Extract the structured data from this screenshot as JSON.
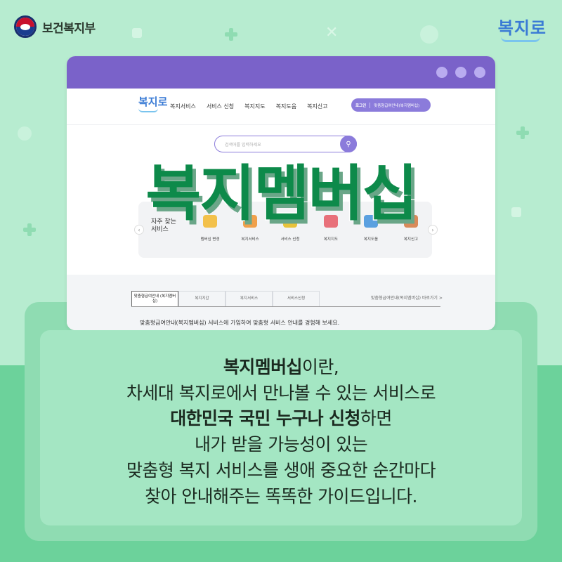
{
  "header": {
    "ministry_name": "보건복지부",
    "brand_logo": "복지로"
  },
  "browser": {
    "window_dots": 3,
    "site": {
      "logo": "복지로",
      "nav_items": [
        "복지서비스",
        "서비스 신청",
        "복지지도",
        "복지도움",
        "복지신고"
      ],
      "login_label": "로그인",
      "login_link": "맞춤형급여안내(복지멤버십)",
      "search_placeholder": "검색어를 입력하세요",
      "frequent_services_title": "자주 찾는 서비스",
      "services": [
        "멤버십 변경",
        "복지서비스",
        "서비스 신청",
        "복지지도",
        "복지도움",
        "복지신고"
      ],
      "tabs": [
        "맞춤형급여안내 (복지멤버십)",
        "복지지갑",
        "복지서비스",
        "서비스신청"
      ],
      "shortcut_link": "맞춤형급여안내(복지멤버십) 바로가기 >",
      "description": "맞춤형급여안내(복지멤버십) 서비스에 가입하여 맞춤형 서비스 안내를 경험해 보세요."
    }
  },
  "headline": "복지멤버십",
  "body_text": {
    "line1_bold": "복지멤버십",
    "line1_rest": "이란,",
    "line2": "차세대 복지로에서 만나볼 수 있는 서비스로",
    "line3_bold": "대한민국 국민 누구나 신청",
    "line3_rest": "하면",
    "line4": "내가 받을 가능성이 있는",
    "line5": "맞춤형 복지 서비스를 생애 중요한 순간마다",
    "line6": "찾아 안내해주는 똑똑한 가이드입니다."
  },
  "colors": {
    "background_top": "#b7ecd0",
    "background_bottom": "#6cd29b",
    "browser_bar": "#7a62c9",
    "headline": "#0d8a4a",
    "accent_purple": "#8b7bdb"
  }
}
